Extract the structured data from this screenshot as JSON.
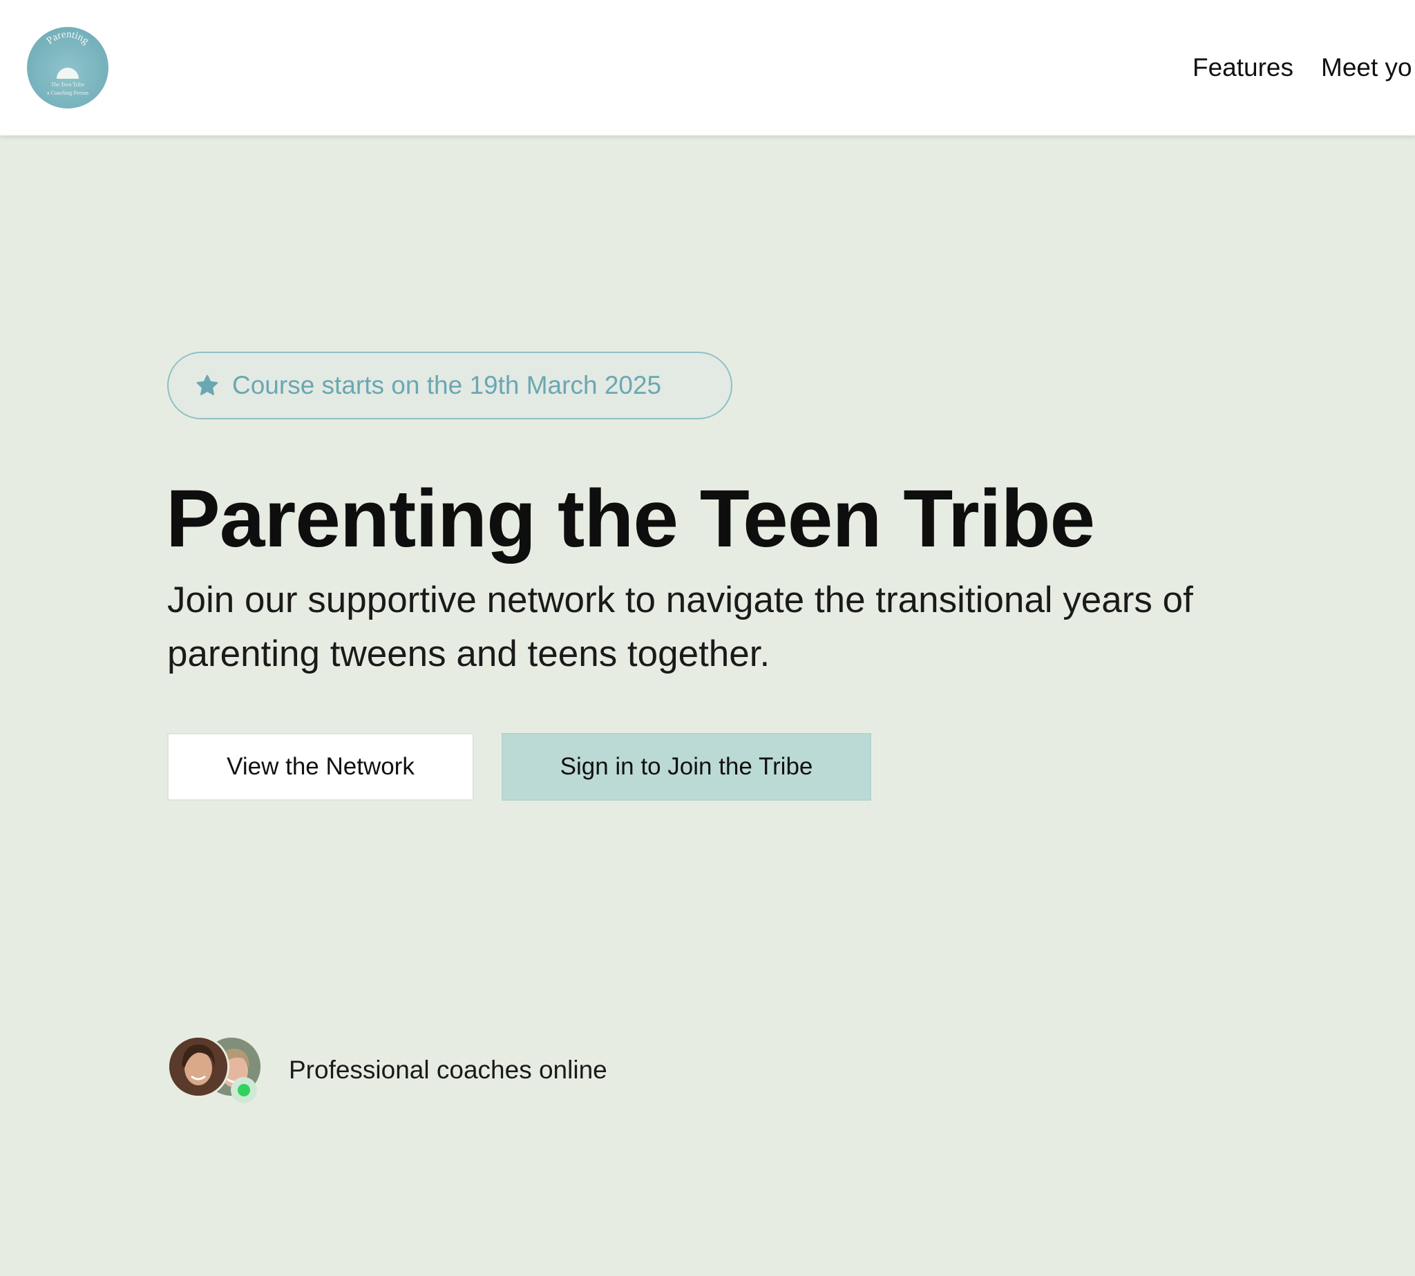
{
  "header": {
    "logo": {
      "arc_text": "Parenting",
      "line_1": "The Teen Tribe",
      "line_2": "a Coaching Person"
    },
    "nav": [
      {
        "label": "Features"
      },
      {
        "label": "Meet yo"
      }
    ]
  },
  "hero": {
    "badge": {
      "icon": "star-icon",
      "text": "Course starts on the 19th March 2025"
    },
    "title": "Parenting the Teen Tribe",
    "subtitle": "Join our supportive network to navigate the transitional years of parenting tweens and teens together.",
    "buttons": {
      "view_label": "View the Network",
      "join_label": "Sign in to Join the Tribe"
    },
    "coaches": {
      "text": "Professional coaches online",
      "status_color": "#2fd35e"
    }
  },
  "colors": {
    "background": "#e7ece2",
    "accent": "#6ba7b2",
    "join_button": "#bcdad5",
    "logo": "#78b3bd"
  }
}
